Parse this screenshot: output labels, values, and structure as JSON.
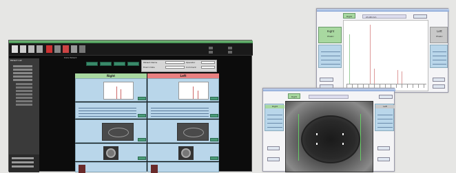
{
  "main_window": {
    "toolbar_text": "Data   Patient",
    "sidebar_title": "Patient List",
    "right_header": "Right",
    "left_header": "Left",
    "info_labels": [
      "Patient Name",
      "Exam Date",
      "Operator",
      "Comment"
    ],
    "row_labels": [
      "Axial Length",
      "K1",
      "K2",
      "AD",
      "LT"
    ]
  },
  "graph_window": {
    "eye_label": "Right",
    "eye_sub": "Phakic",
    "other_eye": "Left",
    "other_sub": "Phakic",
    "axial_value": "23.48 mm"
  },
  "camera_window": {
    "eye_label": "Right",
    "other_label": "Left",
    "status": "Auto"
  },
  "colors": {
    "accent_green": "#3a8a6a",
    "header_green": "#a8d8a0",
    "header_red": "#e88080",
    "panel_blue": "#b9d6ea"
  }
}
